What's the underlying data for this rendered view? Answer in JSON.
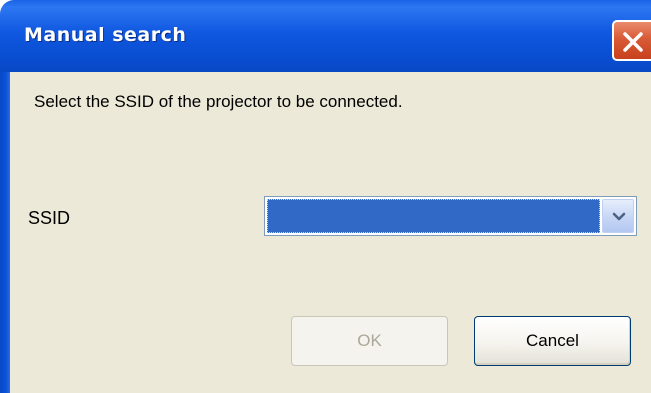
{
  "window": {
    "title": "Manual search"
  },
  "content": {
    "instruction": "Select the SSID of the projector to be connected."
  },
  "ssid": {
    "label": "SSID",
    "selected_value": ""
  },
  "buttons": {
    "ok_label": "OK",
    "cancel_label": "Cancel"
  },
  "colors": {
    "titlebar": "#0a4fd3",
    "close_button": "#d95a37",
    "dialog_background": "#ece9d8",
    "selection_highlight": "#3169c6"
  },
  "icons": {
    "close": "close-x-icon",
    "dropdown": "chevron-down-icon"
  }
}
